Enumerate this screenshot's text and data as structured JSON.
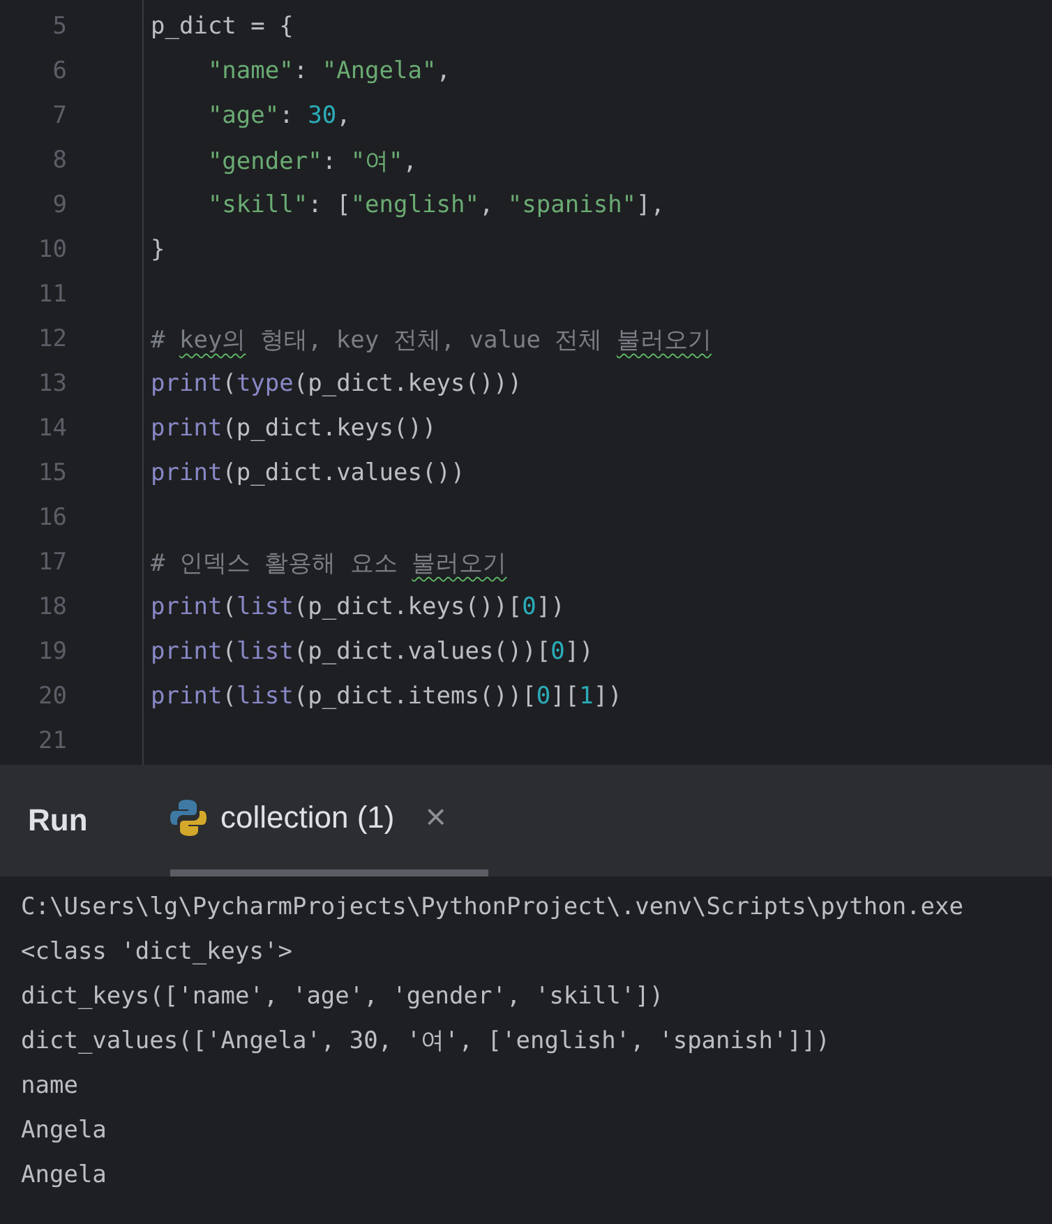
{
  "editor": {
    "lines": [
      {
        "number": "5",
        "tokens": [
          {
            "kind": "plain",
            "text": "p_dict = {"
          }
        ]
      },
      {
        "number": "6",
        "indented": true,
        "tokens": [
          {
            "kind": "string",
            "text": "\"name\""
          },
          {
            "kind": "plain",
            "text": ": "
          },
          {
            "kind": "string",
            "text": "\"Angela\""
          },
          {
            "kind": "plain",
            "text": ","
          }
        ]
      },
      {
        "number": "7",
        "indented": true,
        "tokens": [
          {
            "kind": "string",
            "text": "\"age\""
          },
          {
            "kind": "plain",
            "text": ": "
          },
          {
            "kind": "number",
            "text": "30"
          },
          {
            "kind": "plain",
            "text": ","
          }
        ]
      },
      {
        "number": "8",
        "indented": true,
        "tokens": [
          {
            "kind": "string",
            "text": "\"gender\""
          },
          {
            "kind": "plain",
            "text": ": "
          },
          {
            "kind": "string",
            "text": "\"여\""
          },
          {
            "kind": "plain",
            "text": ","
          }
        ]
      },
      {
        "number": "9",
        "indented": true,
        "tokens": [
          {
            "kind": "string",
            "text": "\"skill\""
          },
          {
            "kind": "plain",
            "text": ": ["
          },
          {
            "kind": "string",
            "text": "\"english\""
          },
          {
            "kind": "plain",
            "text": ", "
          },
          {
            "kind": "string",
            "text": "\"spanish\""
          },
          {
            "kind": "plain",
            "text": "],"
          }
        ]
      },
      {
        "number": "10",
        "tokens": [
          {
            "kind": "plain",
            "text": "}"
          }
        ]
      },
      {
        "number": "11"
      },
      {
        "number": "12",
        "tokens": [
          {
            "kind": "comment",
            "text": "# "
          },
          {
            "kind": "comment",
            "text": "key의",
            "squiggle": true
          },
          {
            "kind": "comment",
            "text": " 형태, key 전체, value 전체 "
          },
          {
            "kind": "comment",
            "text": "불러오기",
            "squiggle": true
          }
        ]
      },
      {
        "number": "13",
        "tokens": [
          {
            "kind": "builtin",
            "text": "print"
          },
          {
            "kind": "plain",
            "text": "("
          },
          {
            "kind": "builtin",
            "text": "type"
          },
          {
            "kind": "plain",
            "text": "(p_dict.keys()))"
          }
        ]
      },
      {
        "number": "14",
        "tokens": [
          {
            "kind": "builtin",
            "text": "print"
          },
          {
            "kind": "plain",
            "text": "(p_dict.keys())"
          }
        ]
      },
      {
        "number": "15",
        "tokens": [
          {
            "kind": "builtin",
            "text": "print"
          },
          {
            "kind": "plain",
            "text": "(p_dict.values())"
          }
        ]
      },
      {
        "number": "16"
      },
      {
        "number": "17",
        "tokens": [
          {
            "kind": "comment",
            "text": "# 인덱스 활용해 요소 "
          },
          {
            "kind": "comment",
            "text": "불러오기",
            "squiggle": true
          }
        ]
      },
      {
        "number": "18",
        "tokens": [
          {
            "kind": "builtin",
            "text": "print"
          },
          {
            "kind": "plain",
            "text": "("
          },
          {
            "kind": "builtin",
            "text": "list"
          },
          {
            "kind": "plain",
            "text": "(p_dict.keys())["
          },
          {
            "kind": "number",
            "text": "0"
          },
          {
            "kind": "plain",
            "text": "])"
          }
        ]
      },
      {
        "number": "19",
        "tokens": [
          {
            "kind": "builtin",
            "text": "print"
          },
          {
            "kind": "plain",
            "text": "("
          },
          {
            "kind": "builtin",
            "text": "list"
          },
          {
            "kind": "plain",
            "text": "(p_dict.values())["
          },
          {
            "kind": "number",
            "text": "0"
          },
          {
            "kind": "plain",
            "text": "])"
          }
        ]
      },
      {
        "number": "20",
        "tokens": [
          {
            "kind": "builtin",
            "text": "print"
          },
          {
            "kind": "plain",
            "text": "("
          },
          {
            "kind": "builtin",
            "text": "list"
          },
          {
            "kind": "plain",
            "text": "(p_dict.items())["
          },
          {
            "kind": "number",
            "text": "0"
          },
          {
            "kind": "plain",
            "text": "]["
          },
          {
            "kind": "number",
            "text": "1"
          },
          {
            "kind": "plain",
            "text": "])"
          }
        ]
      },
      {
        "number": "21"
      }
    ]
  },
  "run_panel": {
    "title": "Run",
    "tabs": [
      {
        "label": "collection (1)",
        "close": "×",
        "selected": true
      }
    ],
    "console": [
      "C:\\Users\\lg\\PycharmProjects\\PythonProject\\.venv\\Scripts\\python.exe",
      "<class 'dict_keys'>",
      "dict_keys(['name', 'age', 'gender', 'skill'])",
      "dict_values(['Angela', 30, '여', ['english', 'spanish']])",
      "name",
      "Angela",
      "Angela"
    ]
  }
}
